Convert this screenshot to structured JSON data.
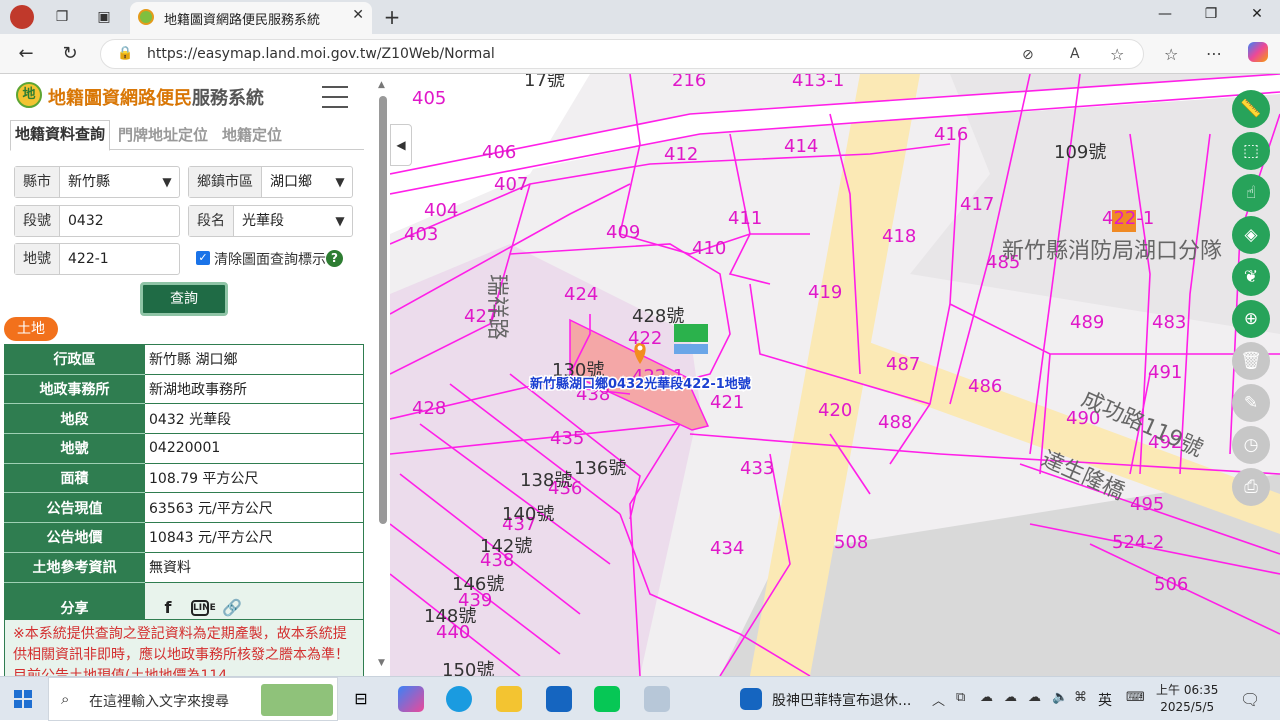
{
  "browser": {
    "tab_title": "地籍圖資網路便民服務系統",
    "url": "https://easymap.land.moi.gov.tw/Z10Web/Normal"
  },
  "app": {
    "title_orange": "地籍圖資網路便民",
    "title_dark": "服務系統",
    "logo_text": "地"
  },
  "tabs": [
    "地籍資料查詢",
    "門牌地址定位",
    "地籍定位"
  ],
  "form": {
    "county_label": "縣市",
    "county_value": "新竹縣",
    "town_label": "鄉鎮市區",
    "town_value": "湖口鄉",
    "section_no_label": "段號",
    "section_no_value": "0432",
    "section_name_label": "段名",
    "section_name_value": "光華段",
    "lot_label": "地號",
    "lot_value": "422-1",
    "clear_label": "清除圖面查詢標示",
    "query_button": "查詢"
  },
  "land_badge": "土地",
  "land_info": [
    {
      "key": "行政區",
      "value": "新竹縣 湖口鄉"
    },
    {
      "key": "地政事務所",
      "value": "新湖地政事務所"
    },
    {
      "key": "地段",
      "value": "0432 光華段"
    },
    {
      "key": "地號",
      "value": "04220001"
    },
    {
      "key": "面積",
      "value": "108.79 平方公尺"
    },
    {
      "key": "公告現值",
      "value": "63563 元/平方公尺"
    },
    {
      "key": "公告地價",
      "value": "10843 元/平方公尺"
    },
    {
      "key": "土地參考資訊",
      "value": "無資料"
    },
    {
      "key": "分享",
      "value": ""
    }
  ],
  "notice": "※本系統提供查詢之登記資料為定期產製，故本系統提供相關資訊非即時，應以地政事務所核發之謄本為準！目前公告土地現值(土地地價為114",
  "map": {
    "selected_label": "新竹縣湖口鄉0432光華段422-1地號",
    "parcel_labels": [
      "405",
      "216",
      "413-1",
      "412",
      "414",
      "416",
      "109號",
      "406",
      "407",
      "404",
      "403",
      "409",
      "411",
      "410",
      "418",
      "417",
      "485",
      "424",
      "427",
      "428號",
      "422",
      "419",
      "489",
      "483",
      "130號",
      "487",
      "486",
      "491",
      "438",
      "421",
      "420",
      "488",
      "490",
      "492",
      "428",
      "435",
      "436號",
      "433",
      "495",
      "136號",
      "138號",
      "436",
      "140號",
      "437",
      "142號",
      "438",
      "434",
      "508",
      "524-2",
      "146號",
      "439",
      "506",
      "148號",
      "440",
      "150號",
      "17號",
      "436",
      "422-1"
    ],
    "road_labels": [
      "新竹縣消防局湖口分隊",
      "成功路119號",
      "達生隆橋",
      "瑞祥路"
    ],
    "highlight_color": "#f4a7a7",
    "parcel_line_color": "#ff1fe8"
  },
  "taskbar": {
    "search_placeholder": "在這裡輸入文字來搜尋",
    "news": "股神巴菲特宣布退休...",
    "ime": "英",
    "time": "上午 06:35",
    "date": "2025/5/5"
  }
}
